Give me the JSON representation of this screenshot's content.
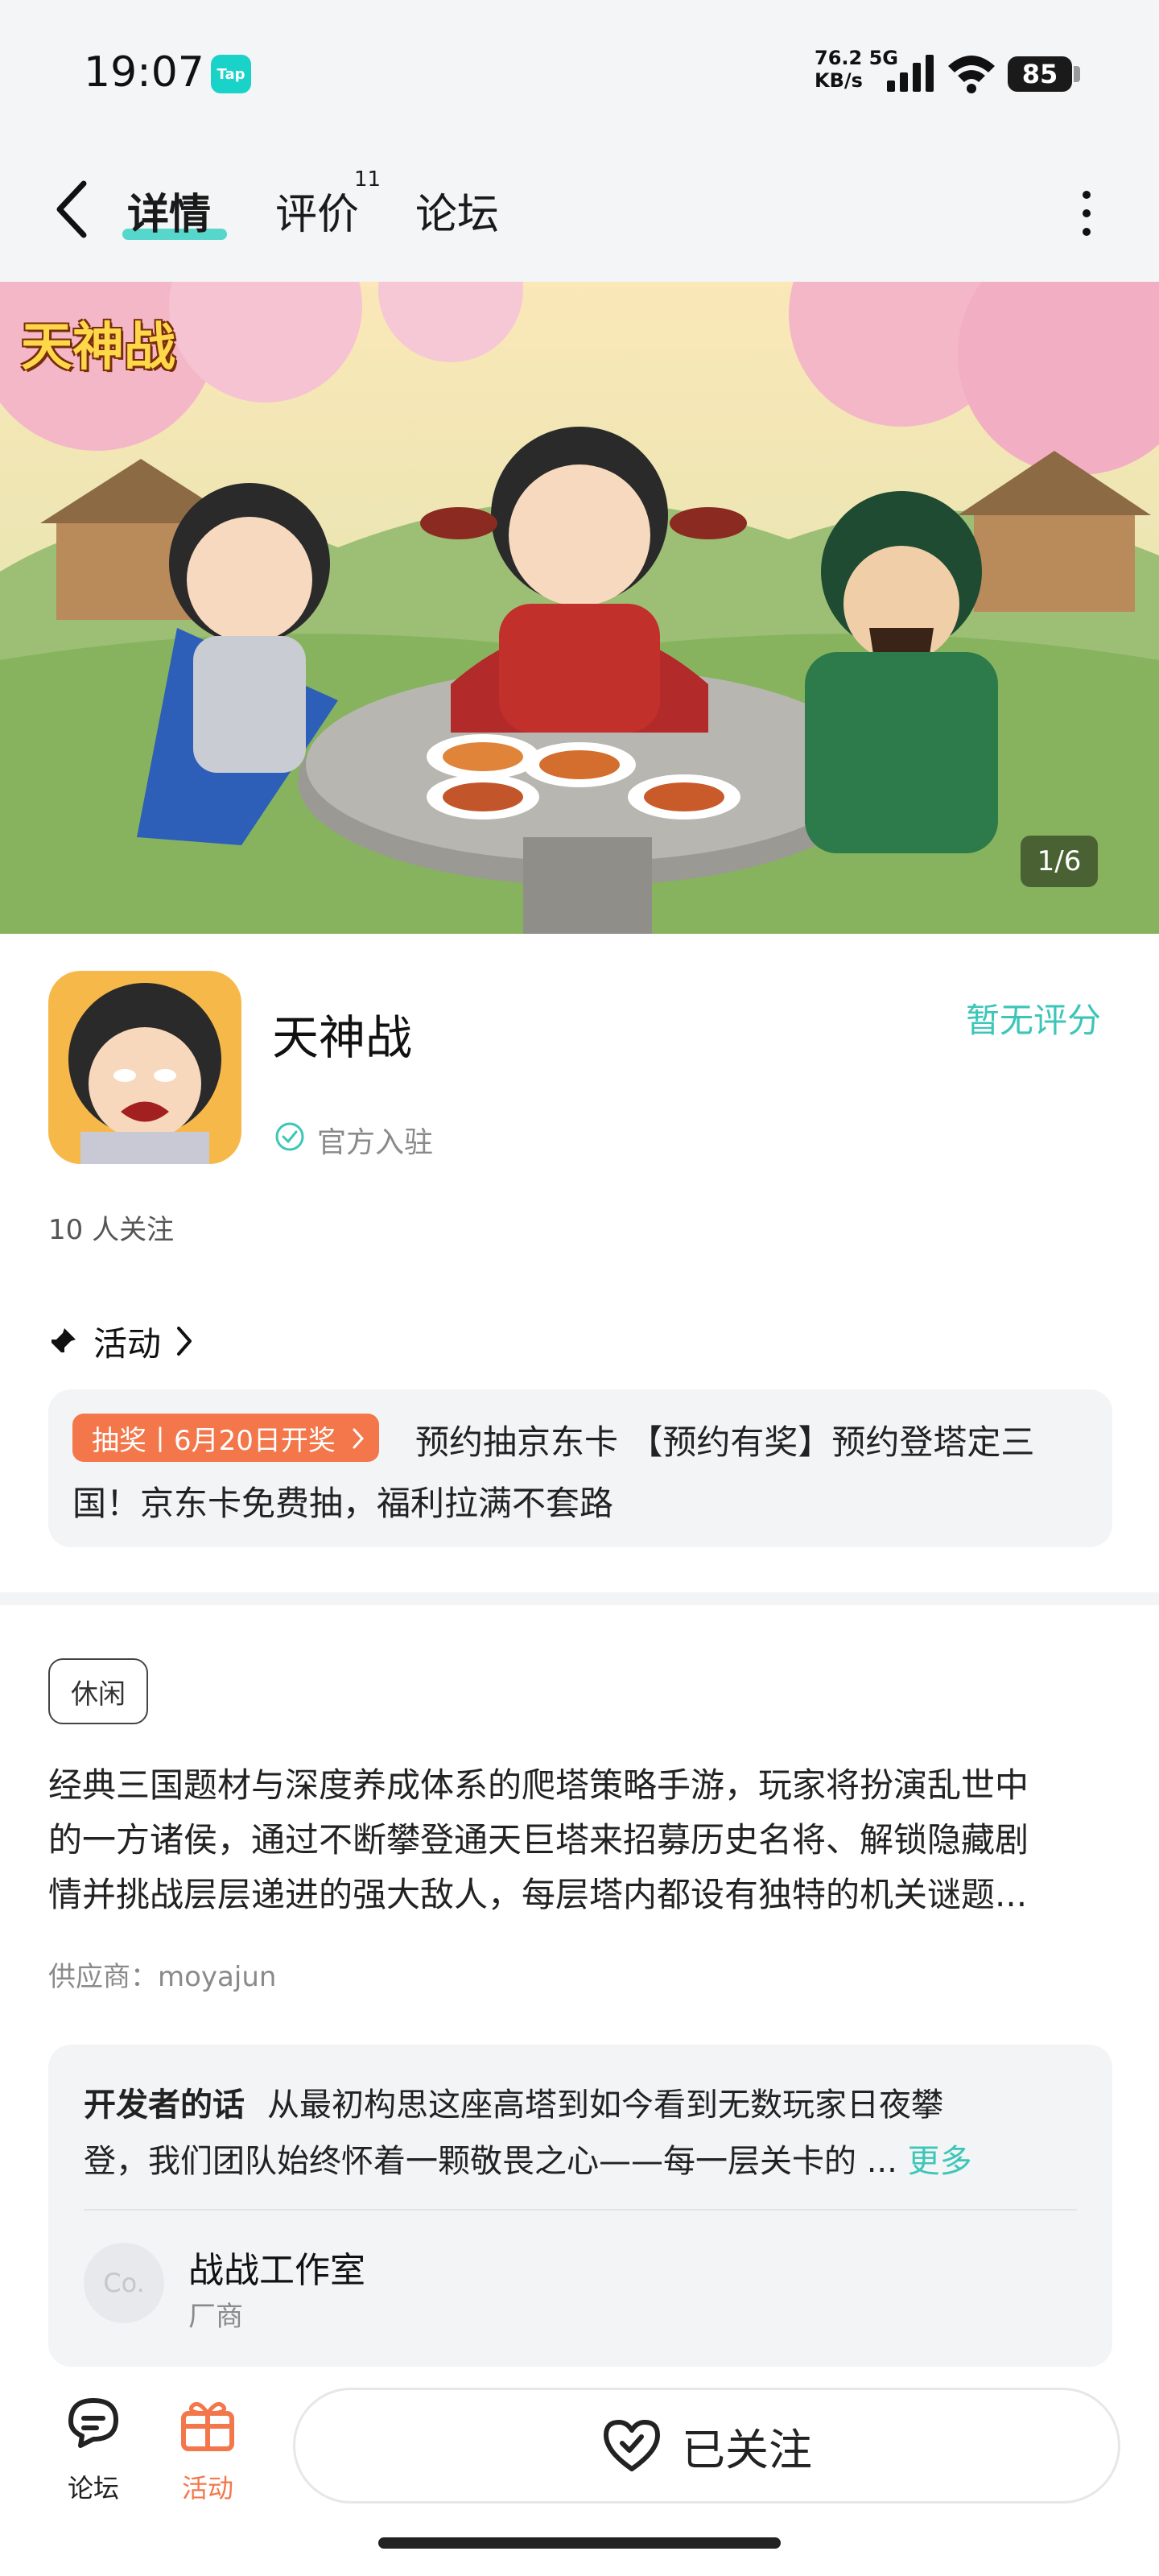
{
  "status_bar": {
    "time": "19:07",
    "app_badge": "Tap",
    "net_speed_value": "76.2",
    "net_speed_unit": "KB/s",
    "network": "5G",
    "battery": "85",
    "icons": [
      "signal-icon",
      "wifi-icon",
      "battery-icon"
    ]
  },
  "nav": {
    "tabs": [
      {
        "label": "详情",
        "active": true
      },
      {
        "label": "评价",
        "count": "11"
      },
      {
        "label": "论坛"
      }
    ],
    "accent": "#2fd0c0"
  },
  "banner": {
    "logo_text": "天神战",
    "pager": "1/6"
  },
  "game": {
    "name": "天神战",
    "rating_text": "暂无评分",
    "verified_text": "官方入驻",
    "followers_text": "10 人关注"
  },
  "activity": {
    "section_title": "活动",
    "badge": "抽奖丨6月20日开奖",
    "badge_color": "#f3774a",
    "line1": "预约抽京东卡 【预约有奖】预约登塔定三",
    "line2": "国！京东卡免费抽，福利拉满不套路"
  },
  "details": {
    "tag": "休闲",
    "description_lines": [
      "经典三国题材与深度养成体系的爬塔策略手游，玩家将扮演乱世中",
      "的一方诸侯，通过不断攀登通天巨塔来招募历史名将、解锁隐藏剧",
      "情并挑战层层递进的强大敌人，每层塔内都设有独特的机关谜题..."
    ],
    "supplier": "供应商：moyajun"
  },
  "developer": {
    "label": "开发者的话",
    "line1": "从最初构思这座高塔到如今看到无数玩家日夜攀",
    "line2": "登，我们团队始终怀着一颗敬畏之心——每一层关卡的 ...",
    "more": "更多",
    "avatar_text": "Co.",
    "studio": "战战工作室",
    "role": "厂商"
  },
  "bottom": {
    "forum_label": "论坛",
    "activity_label": "活动",
    "activity_color": "#f3774a",
    "follow_label": "已关注"
  }
}
